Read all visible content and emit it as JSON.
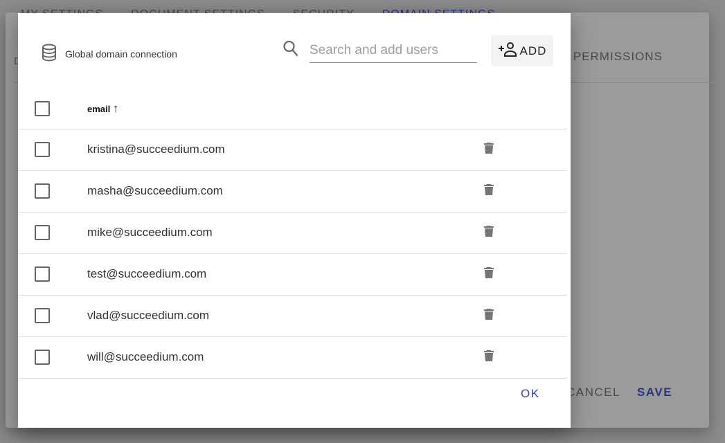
{
  "background": {
    "tabs": [
      "MY SETTINGS",
      "DOCUMENT SETTINGS",
      "SECURITY",
      "DOMAIN SETTINGS"
    ],
    "active_tab": 3,
    "left_fragment": "D",
    "permissions_label": "PERMISSIONS",
    "cancel_label": "CANCEL",
    "save_label": "SAVE"
  },
  "dialog": {
    "connection_label": "Global domain connection",
    "search": {
      "placeholder": "Search and add users",
      "value": ""
    },
    "add_label": "ADD",
    "table": {
      "column_header": "email",
      "sort": "ascending",
      "rows": [
        {
          "email": "kristina@succeedium.com"
        },
        {
          "email": "masha@succeedium.com"
        },
        {
          "email": "mike@succeedium.com"
        },
        {
          "email": "test@succeedium.com"
        },
        {
          "email": "vlad@succeedium.com"
        },
        {
          "email": "will@succeedium.com"
        }
      ]
    },
    "ok_label": "OK"
  },
  "colors": {
    "accent": "#3546b5",
    "overlay": "#8c8c8c"
  }
}
